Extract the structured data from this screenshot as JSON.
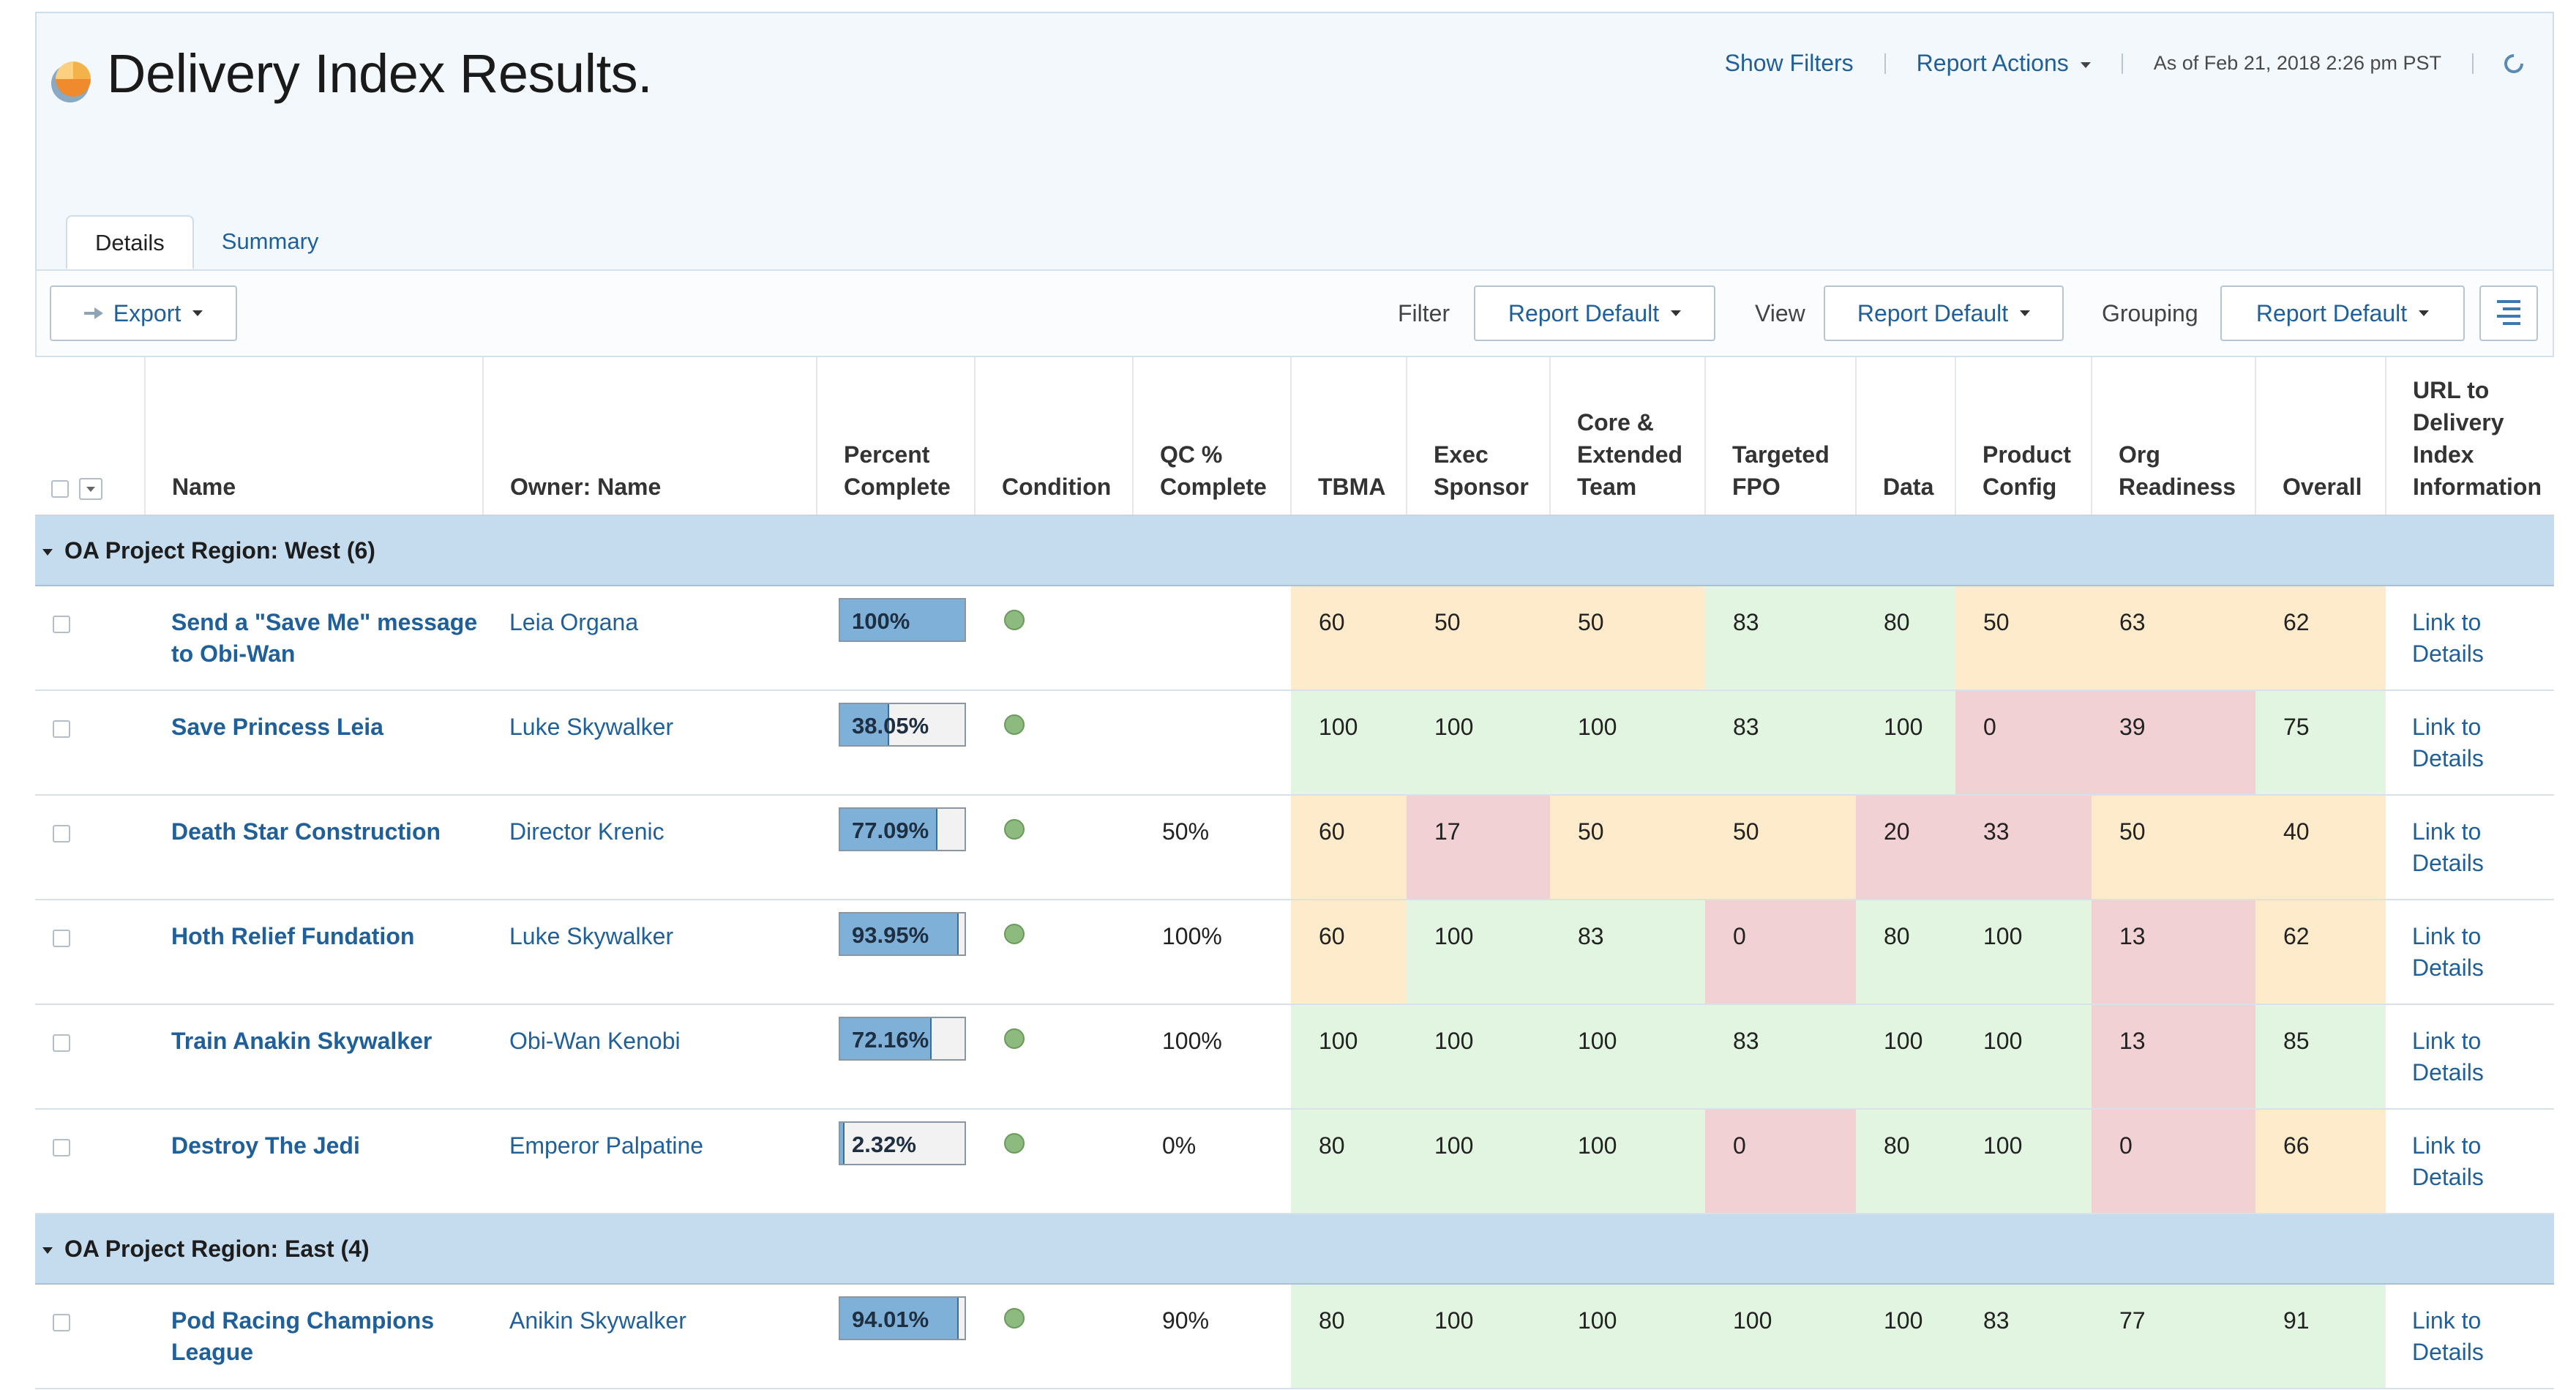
{
  "header": {
    "title": "Delivery Index Results.",
    "show_filters": "Show Filters",
    "report_actions": "Report Actions",
    "as_of": "As of Feb 21, 2018 2:26 pm PST"
  },
  "tabs": [
    {
      "label": "Details",
      "active": true
    },
    {
      "label": "Summary",
      "active": false
    }
  ],
  "toolbar": {
    "export_label": "Export",
    "filter_label": "Filter",
    "filter_value": "Report Default",
    "view_label": "View",
    "view_value": "Report Default",
    "grouping_label": "Grouping",
    "grouping_value": "Report Default"
  },
  "columns": {
    "name": "Name",
    "owner": "Owner: Name",
    "percent": [
      "Percent",
      "Complete"
    ],
    "condition": "Condition",
    "qc": [
      "QC %",
      "Complete"
    ],
    "tbma": "TBMA",
    "exec": [
      "Exec",
      "Sponsor"
    ],
    "core": [
      "Core &",
      "Extended",
      "Team"
    ],
    "fpo": [
      "Targeted",
      "FPO"
    ],
    "data": "Data",
    "product": [
      "Product",
      "Config"
    ],
    "org": [
      "Org",
      "Readiness"
    ],
    "overall": "Overall",
    "url": [
      "URL to",
      "Delivery",
      "Index",
      "Information"
    ]
  },
  "condition_color": "#8dbb7f",
  "score_colors": {
    "green": "#e2f5e0",
    "orange": "#fdebcc",
    "red": "#f1d1d4"
  },
  "groups": [
    {
      "label": "OA Project Region: West (6)",
      "rows": [
        {
          "name": "Send a \"Save Me\" message to Obi-Wan",
          "owner": "Leia Organa",
          "percent_text": "100%",
          "percent": 100,
          "qc": "",
          "tbma": "60",
          "exec": "50",
          "core": "50",
          "fpo": "83",
          "data": "80",
          "product": "50",
          "org": "63",
          "overall": "62",
          "link1": "Link to",
          "link2": "Details"
        },
        {
          "name": "Save Princess Leia",
          "owner": "Luke Skywalker",
          "percent_text": "38.05%",
          "percent": 38.05,
          "qc": "",
          "tbma": "100",
          "exec": "100",
          "core": "100",
          "fpo": "83",
          "data": "100",
          "product": "0",
          "org": "39",
          "overall": "75",
          "link1": "Link to",
          "link2": "Details"
        },
        {
          "name": "Death Star Construction",
          "owner": "Director Krenic",
          "percent_text": "77.09%",
          "percent": 77.09,
          "qc": "50%",
          "tbma": "60",
          "exec": "17",
          "core": "50",
          "fpo": "50",
          "data": "20",
          "product": "33",
          "org": "50",
          "overall": "40",
          "link1": "Link to",
          "link2": "Details"
        },
        {
          "name": "Hoth Relief Fundation",
          "owner": "Luke Skywalker",
          "percent_text": "93.95%",
          "percent": 93.95,
          "qc": "100%",
          "tbma": "60",
          "exec": "100",
          "core": "83",
          "fpo": "0",
          "data": "80",
          "product": "100",
          "org": "13",
          "overall": "62",
          "link1": "Link to",
          "link2": "Details"
        },
        {
          "name": "Train Anakin Skywalker",
          "owner": "Obi-Wan Kenobi",
          "percent_text": "72.16%",
          "percent": 72.16,
          "qc": "100%",
          "tbma": "100",
          "exec": "100",
          "core": "100",
          "fpo": "83",
          "data": "100",
          "product": "100",
          "org": "13",
          "overall": "85",
          "link1": "Link to",
          "link2": "Details"
        },
        {
          "name": "Destroy The Jedi",
          "owner": "Emperor Palpatine",
          "percent_text": "2.32%",
          "percent": 2.32,
          "qc": "0%",
          "tbma": "80",
          "exec": "100",
          "core": "100",
          "fpo": "0",
          "data": "80",
          "product": "100",
          "org": "0",
          "overall": "66",
          "link1": "Link to",
          "link2": "Details"
        }
      ]
    },
    {
      "label": "OA Project Region: East (4)",
      "rows": [
        {
          "name": "Pod Racing Champions League",
          "owner": "Anikin Skywalker",
          "percent_text": "94.01%",
          "percent": 94.01,
          "qc": "90%",
          "tbma": "80",
          "exec": "100",
          "core": "100",
          "fpo": "100",
          "data": "100",
          "product": "83",
          "org": "77",
          "overall": "91",
          "link1": "Link to",
          "link2": "Details"
        }
      ]
    }
  ]
}
